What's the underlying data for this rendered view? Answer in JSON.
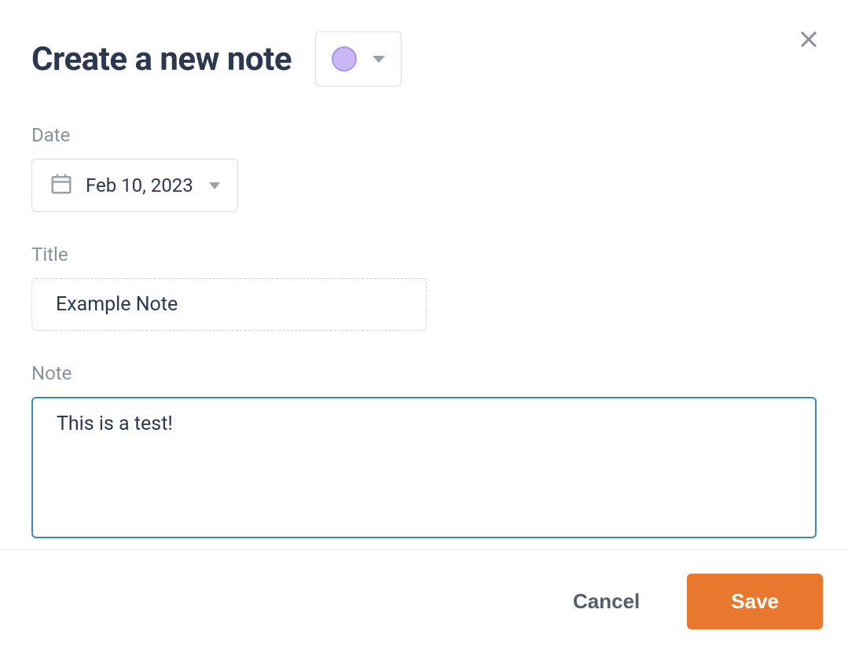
{
  "modal": {
    "title": "Create a new note",
    "color_picker": {
      "selected_color": "#c9b8f5",
      "border_color": "#a996e8"
    }
  },
  "fields": {
    "date": {
      "label": "Date",
      "value": "Feb 10, 2023"
    },
    "title": {
      "label": "Title",
      "value": "Example Note"
    },
    "note": {
      "label": "Note",
      "value": "This is a test!"
    }
  },
  "actions": {
    "cancel": "Cancel",
    "save": "Save"
  },
  "colors": {
    "accent": "#e8782d",
    "focus_border": "#3b89c9",
    "text_primary": "#2c3750",
    "text_muted": "#8a919c"
  }
}
